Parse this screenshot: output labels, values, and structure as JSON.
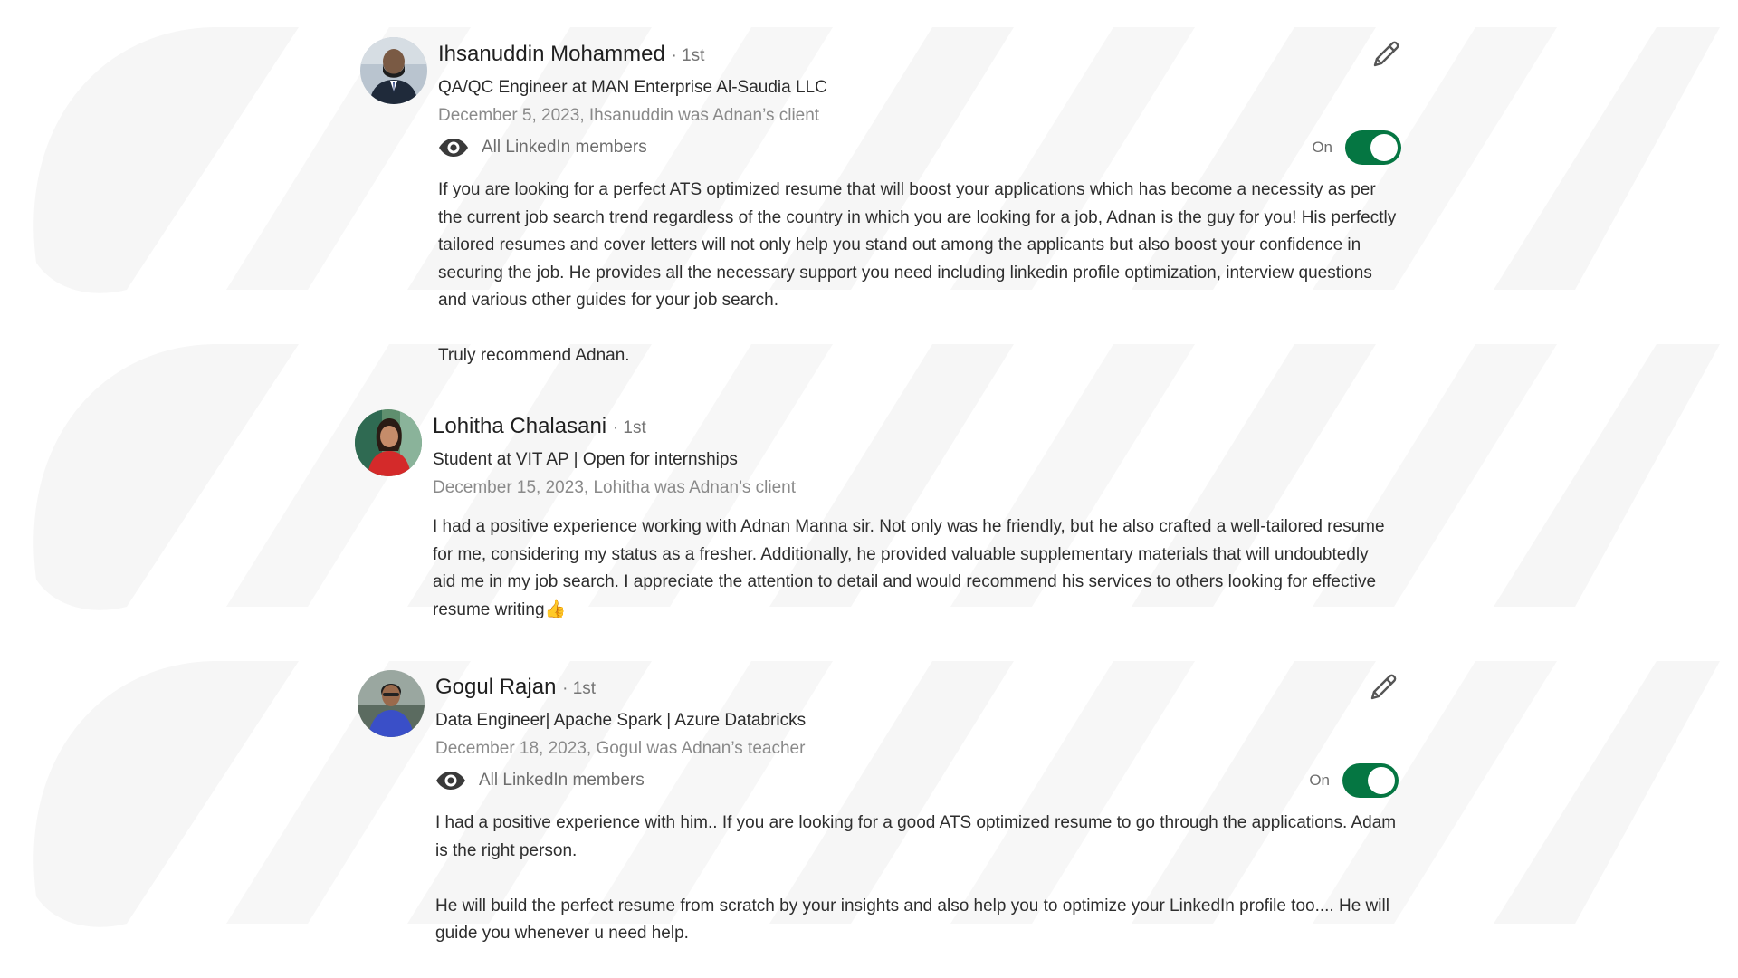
{
  "recommendations": [
    {
      "name": "Ihsanuddin Mohammed",
      "degree": "· 1st",
      "headline": "QA/QC Engineer at MAN Enterprise Al-Saudia LLC",
      "meta": "December 5, 2023, Ihsanuddin was Adnan’s client",
      "visibility": "All LinkedIn members",
      "toggle_label": "On",
      "paragraphs": [
        "If you are looking for a perfect ATS optimized resume that will boost your applications which has become a necessity as per the current job search trend regardless of the country in which you are looking for a job, Adnan is the guy for you! His perfectly tailored resumes and cover letters will not only help you stand out among the applicants but also boost your confidence in securing the job. He provides all the necessary support you need including linkedin profile optimization, interview questions and various other guides for your job search.",
        "Truly recommend Adnan."
      ]
    },
    {
      "name": "Lohitha Chalasani",
      "degree": "· 1st",
      "headline": "Student at VIT AP | Open for internships",
      "meta": "December 15, 2023, Lohitha was Adnan’s client",
      "paragraphs": [
        "I had a positive experience working with Adnan Manna sir. Not only was he friendly, but he also crafted a well-tailored resume for me, considering my status as a fresher. Additionally, he provided valuable supplementary materials that will undoubtedly aid me in my job search. I appreciate the attention to detail and would recommend his services to others looking for effective resume writing👍"
      ]
    },
    {
      "name": "Gogul Rajan",
      "degree": "· 1st",
      "headline": "Data Engineer| Apache Spark | Azure Databricks",
      "meta": "December 18, 2023, Gogul was Adnan’s teacher",
      "visibility": "All LinkedIn members",
      "toggle_label": "On",
      "paragraphs": [
        "I had a positive experience with him.. If you are looking for a good ATS optimized resume to go through the applications. Adam is the right person.",
        "He will build the perfect resume from scratch by your insights and also help you to optimize your LinkedIn profile too.... He will guide you whenever u need help."
      ]
    }
  ],
  "icons": {
    "edit": "pencil-icon",
    "visibility": "eye-icon"
  },
  "colors": {
    "toggle_on": "#057642",
    "background": "#ffffff"
  }
}
